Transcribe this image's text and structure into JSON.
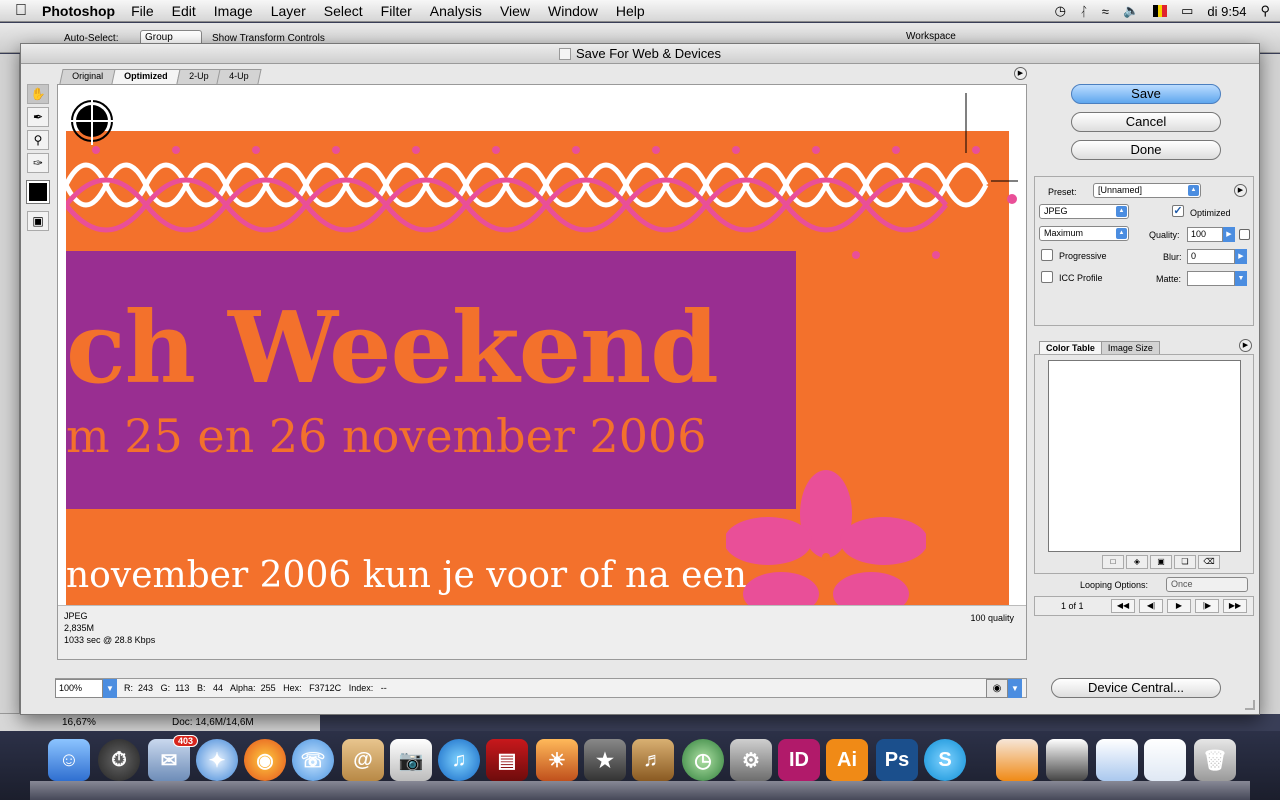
{
  "menubar": {
    "app": "Photoshop",
    "items": [
      "File",
      "Edit",
      "Image",
      "Layer",
      "Select",
      "Filter",
      "Analysis",
      "View",
      "Window",
      "Help"
    ],
    "clock": "di 9:54"
  },
  "ps": {
    "auto_select": "Auto-Select:",
    "auto_select_value": "Group",
    "show_transform": "Show Transform Controls",
    "workspace": "Workspace",
    "status_zoom": "16,67%",
    "status_doc": "Doc: 14,6M/14,6M"
  },
  "dialog": {
    "title": "Save For Web & Devices",
    "tabs": [
      "Original",
      "Optimized",
      "2-Up",
      "4-Up"
    ],
    "active_tab": "Optimized",
    "save": "Save",
    "cancel": "Cancel",
    "done": "Done",
    "device_central": "Device Central..."
  },
  "preview": {
    "headline": "ch Weekend",
    "subline": "m 25 en 26 november 2006",
    "footline": "november 2006 kun je voor of na een",
    "colors": {
      "orange": "#f3712c",
      "purple": "#992e91",
      "pink": "#e94f98"
    }
  },
  "info": {
    "format": "JPEG",
    "size": "2,835M",
    "time": "1033 sec @ 28.8 Kbps",
    "quality": "100 quality"
  },
  "settings": {
    "preset_label": "Preset:",
    "preset_value": "[Unnamed]",
    "format": "JPEG",
    "optimized_label": "Optimized",
    "optimized_checked": true,
    "quality_preset": "Maximum",
    "quality_label": "Quality:",
    "quality_value": "100",
    "progressive_label": "Progressive",
    "blur_label": "Blur:",
    "blur_value": "0",
    "icc_label": "ICC Profile",
    "matte_label": "Matte:"
  },
  "color_table": {
    "tabs": [
      "Color Table",
      "Image Size"
    ],
    "looping_label": "Looping Options:",
    "looping_value": "Once",
    "frame": "1 of 1"
  },
  "bottom_bar": {
    "zoom": "100%",
    "r_label": "R:",
    "r": "243",
    "g_label": "G:",
    "g": "113",
    "b_label": "B:",
    "b": "44",
    "alpha_label": "Alpha:",
    "alpha": "255",
    "hex_label": "Hex:",
    "hex": "F3712C",
    "index_label": "Index:",
    "index": "--"
  },
  "dock": {
    "mail_badge": "403",
    "id_label": "ID",
    "ai_label": "Ai",
    "ps_label": "Ps"
  }
}
